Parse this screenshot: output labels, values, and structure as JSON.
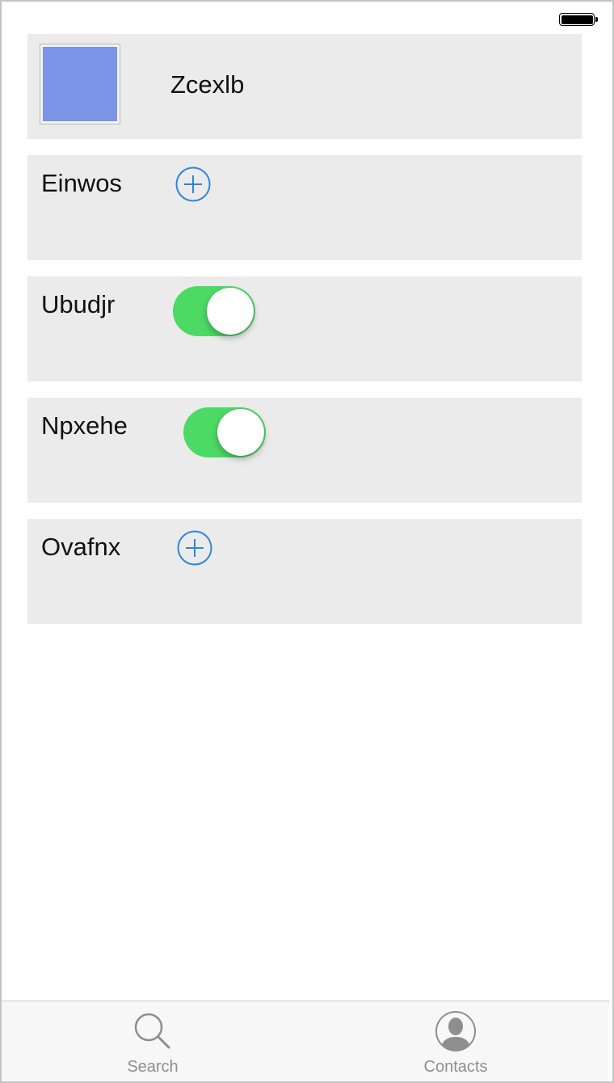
{
  "colors": {
    "avatar": "#7b94e6",
    "accent": "#2f84e0",
    "toggle_on": "#4cd964",
    "card_bg": "#ebebeb",
    "tab_inactive": "#8e8e8e"
  },
  "status_bar": {
    "battery_level": 1.0
  },
  "profile": {
    "name": "Zcexlb"
  },
  "rows": [
    {
      "label": "Einwos",
      "control": "add-button"
    },
    {
      "label": "Ubudjr",
      "control": "toggle",
      "on": true
    },
    {
      "label": "Npxehe",
      "control": "toggle",
      "on": true
    },
    {
      "label": "Ovafnx",
      "control": "add-button"
    }
  ],
  "tab_bar": {
    "tabs": [
      {
        "label": "Search",
        "icon": "search-icon"
      },
      {
        "label": "Contacts",
        "icon": "contacts-icon"
      }
    ]
  }
}
